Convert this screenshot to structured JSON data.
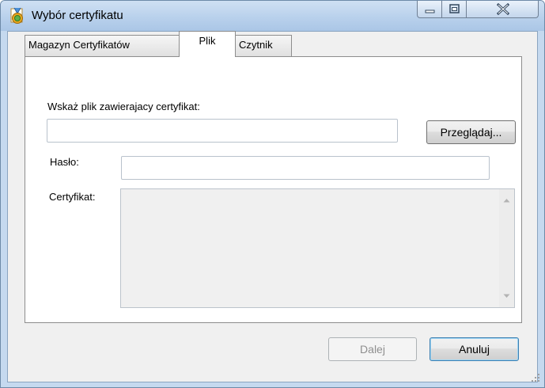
{
  "window": {
    "title": "Wybór certyfikatu",
    "icon": "certificate-medal-icon"
  },
  "tabs": [
    {
      "label": "Magazyn Certyfikatów",
      "selected": false
    },
    {
      "label": "Plik",
      "selected": true
    },
    {
      "label": "Czytnik",
      "selected": false
    }
  ],
  "file_tab": {
    "file_prompt": "Wskaż plik zawierajacy certyfikat:",
    "file_path_value": "",
    "browse_label": "Przeglądaj...",
    "password_label": "Hasło:",
    "password_value": "",
    "certificate_label": "Certyfikat:",
    "certificate_value": ""
  },
  "footer": {
    "next_label": "Dalej",
    "next_enabled": false,
    "cancel_label": "Anuluj"
  }
}
